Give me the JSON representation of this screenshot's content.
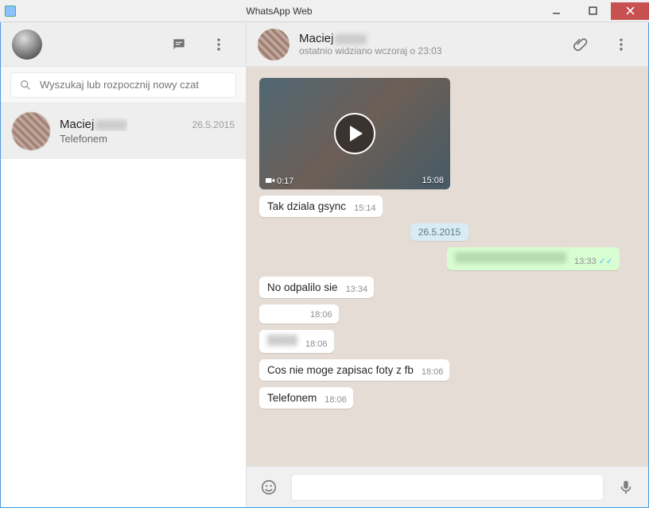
{
  "window": {
    "title": "WhatsApp Web"
  },
  "sidebar": {
    "search_placeholder": "Wyszukaj lub rozpocznij nowy czat",
    "contacts": [
      {
        "name_prefix": "Maciej",
        "date": "26.5.2015",
        "preview": "Telefonem"
      }
    ]
  },
  "chat": {
    "name_prefix": "Maciej",
    "status": "ostatnio widziano wczoraj o 23:03",
    "video": {
      "duration": "0:17",
      "time": "15:08"
    },
    "date_chip": "26.5.2015",
    "messages": [
      {
        "id": "in1",
        "text": "Tak dziala gsync",
        "time": "15:14"
      },
      {
        "id": "out1",
        "time": "13:33"
      },
      {
        "id": "in2",
        "text": "No odpalilo sie",
        "time": "13:34"
      },
      {
        "id": "in3",
        "text": "",
        "time": "18:06"
      },
      {
        "id": "in4",
        "time": "18:06"
      },
      {
        "id": "in5",
        "text": "Cos nie moge zapisac foty z fb",
        "time": "18:06"
      },
      {
        "id": "in6",
        "text": "Telefonem",
        "time": "18:06"
      }
    ]
  },
  "compose": {
    "placeholder": ""
  }
}
